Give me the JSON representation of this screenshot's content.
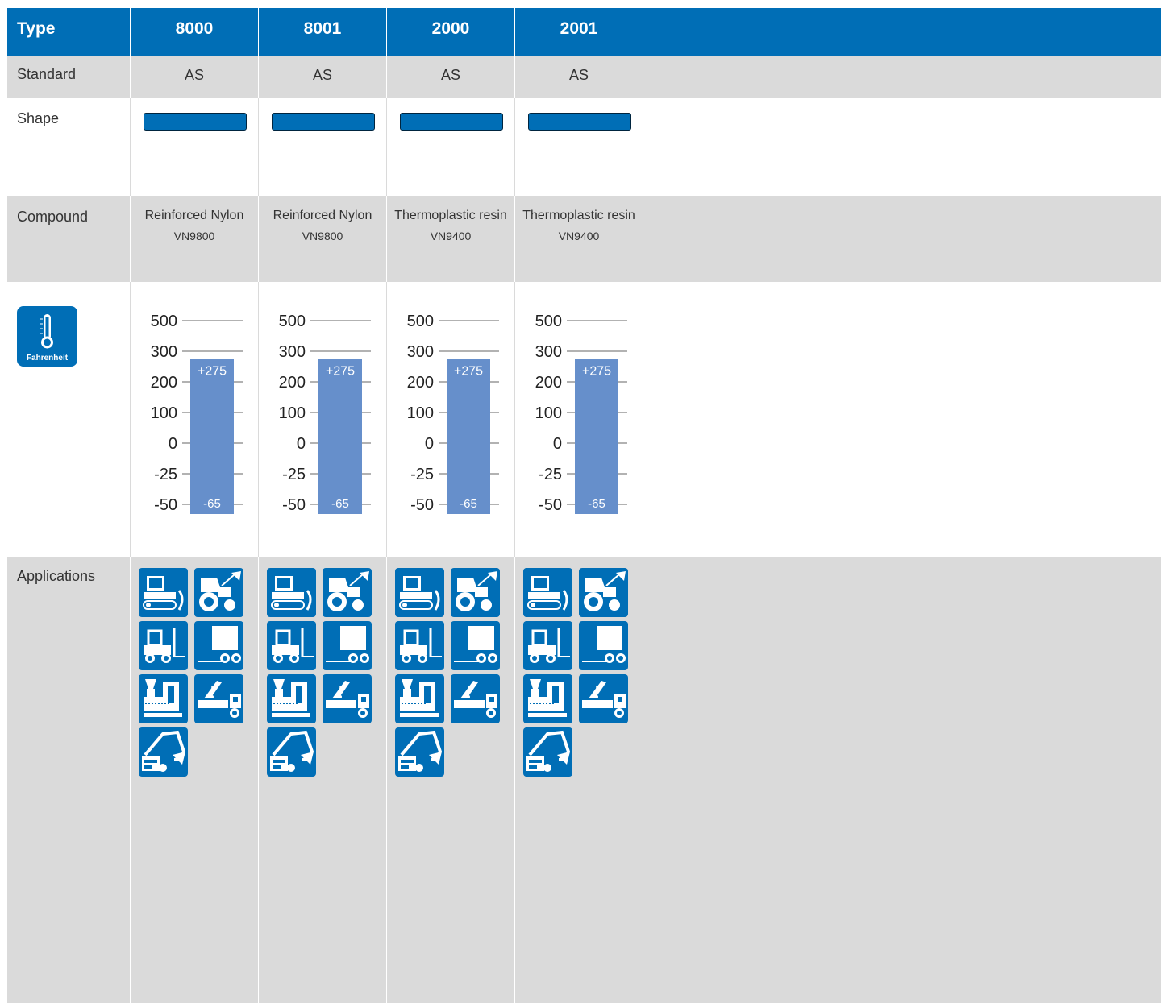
{
  "header": {
    "type_label": "Type",
    "columns": [
      "8000",
      "8001",
      "2000",
      "2001"
    ]
  },
  "rows": {
    "standard": {
      "label": "Standard",
      "values": [
        "AS",
        "AS",
        "AS",
        "AS"
      ]
    },
    "shape": {
      "label": "Shape"
    },
    "compound": {
      "label": "Compound",
      "values": [
        {
          "name": "Reinforced Nylon",
          "code": "VN9800"
        },
        {
          "name": "Reinforced Nylon",
          "code": "VN9800"
        },
        {
          "name": "Thermoplastic resin",
          "code": "VN9400"
        },
        {
          "name": "Thermoplastic resin",
          "code": "VN9400"
        }
      ]
    },
    "temperature": {
      "badge_label": "Fahrenheit",
      "badge_icon": "thermometer-icon"
    },
    "applications": {
      "label": "Applications",
      "icons": [
        "bulldozer-icon",
        "agricultural-tractor-icon",
        "forklift-icon",
        "truck-trailer-icon",
        "injection-molding-machine-icon",
        "crane-truck-icon",
        "excavator-icon"
      ]
    }
  },
  "colors": {
    "brand_blue": "#006eb6",
    "bar_blue": "#668fcb",
    "row_gray": "#dadada"
  },
  "chart_data": [
    {
      "type": "bar",
      "column": "8000",
      "tick_labels": [
        "500",
        "300",
        "200",
        "100",
        "0",
        "-25",
        "-50"
      ],
      "range": {
        "max": 275,
        "min": -65
      },
      "max_label": "+275",
      "min_label": "-65"
    },
    {
      "type": "bar",
      "column": "8001",
      "tick_labels": [
        "500",
        "300",
        "200",
        "100",
        "0",
        "-25",
        "-50"
      ],
      "range": {
        "max": 275,
        "min": -65
      },
      "max_label": "+275",
      "min_label": "-65"
    },
    {
      "type": "bar",
      "column": "2000",
      "tick_labels": [
        "500",
        "300",
        "200",
        "100",
        "0",
        "-25",
        "-50"
      ],
      "range": {
        "max": 275,
        "min": -65
      },
      "max_label": "+275",
      "min_label": "-65"
    },
    {
      "type": "bar",
      "column": "2001",
      "tick_labels": [
        "500",
        "300",
        "200",
        "100",
        "0",
        "-25",
        "-50"
      ],
      "range": {
        "max": 275,
        "min": -65
      },
      "max_label": "+275",
      "min_label": "-65"
    }
  ]
}
